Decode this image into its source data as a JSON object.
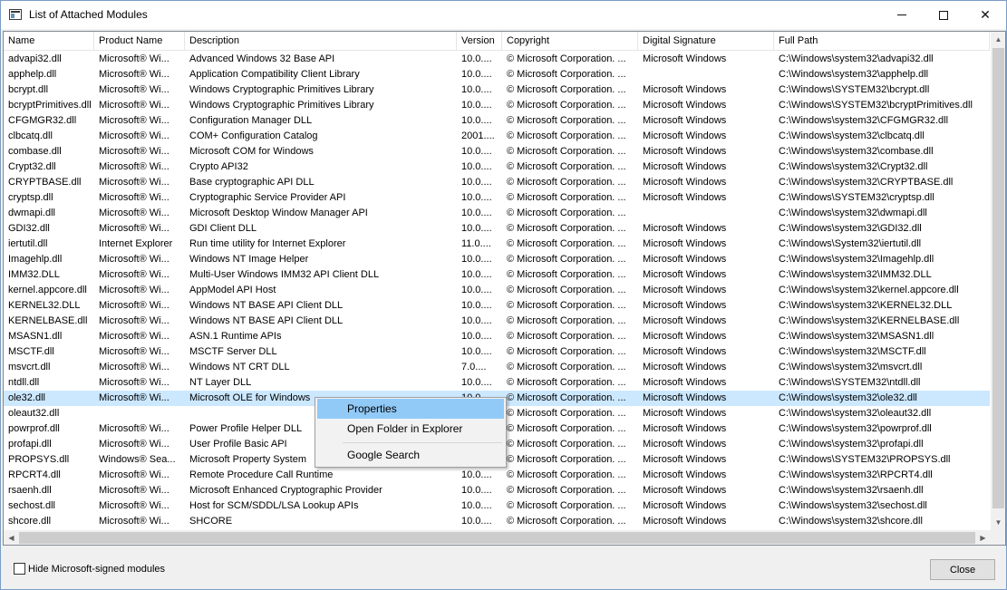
{
  "window": {
    "title": "List of Attached Modules",
    "min_icon": "minimize-icon",
    "max_icon": "maximize-icon",
    "close_icon": "close-icon",
    "close_glyph": "✕"
  },
  "columns": [
    "Name",
    "Product Name",
    "Description",
    "Version",
    "Copyright",
    "Digital Signature",
    "Full Path"
  ],
  "rows": [
    [
      "advapi32.dll",
      "Microsoft® Wi...",
      "Advanced Windows 32 Base API",
      "10.0....",
      "© Microsoft Corporation. ...",
      "Microsoft Windows",
      "C:\\Windows\\system32\\advapi32.dll"
    ],
    [
      "apphelp.dll",
      "Microsoft® Wi...",
      "Application Compatibility Client Library",
      "10.0....",
      "© Microsoft Corporation. ...",
      "",
      "C:\\Windows\\system32\\apphelp.dll"
    ],
    [
      "bcrypt.dll",
      "Microsoft® Wi...",
      "Windows Cryptographic Primitives Library",
      "10.0....",
      "© Microsoft Corporation. ...",
      "Microsoft Windows",
      "C:\\Windows\\SYSTEM32\\bcrypt.dll"
    ],
    [
      "bcryptPrimitives.dll",
      "Microsoft® Wi...",
      "Windows Cryptographic Primitives Library",
      "10.0....",
      "© Microsoft Corporation. ...",
      "Microsoft Windows",
      "C:\\Windows\\SYSTEM32\\bcryptPrimitives.dll"
    ],
    [
      "CFGMGR32.dll",
      "Microsoft® Wi...",
      "Configuration Manager DLL",
      "10.0....",
      "© Microsoft Corporation. ...",
      "Microsoft Windows",
      "C:\\Windows\\system32\\CFGMGR32.dll"
    ],
    [
      "clbcatq.dll",
      "Microsoft® Wi...",
      "COM+ Configuration Catalog",
      "2001....",
      "© Microsoft Corporation. ...",
      "Microsoft Windows",
      "C:\\Windows\\system32\\clbcatq.dll"
    ],
    [
      "combase.dll",
      "Microsoft® Wi...",
      "Microsoft COM for Windows",
      "10.0....",
      "© Microsoft Corporation. ...",
      "Microsoft Windows",
      "C:\\Windows\\system32\\combase.dll"
    ],
    [
      "Crypt32.dll",
      "Microsoft® Wi...",
      "Crypto API32",
      "10.0....",
      "© Microsoft Corporation. ...",
      "Microsoft Windows",
      "C:\\Windows\\system32\\Crypt32.dll"
    ],
    [
      "CRYPTBASE.dll",
      "Microsoft® Wi...",
      "Base cryptographic API DLL",
      "10.0....",
      "© Microsoft Corporation. ...",
      "Microsoft Windows",
      "C:\\Windows\\system32\\CRYPTBASE.dll"
    ],
    [
      "cryptsp.dll",
      "Microsoft® Wi...",
      "Cryptographic Service Provider API",
      "10.0....",
      "© Microsoft Corporation. ...",
      "Microsoft Windows",
      "C:\\Windows\\SYSTEM32\\cryptsp.dll"
    ],
    [
      "dwmapi.dll",
      "Microsoft® Wi...",
      "Microsoft Desktop Window Manager API",
      "10.0....",
      "© Microsoft Corporation. ...",
      "",
      "C:\\Windows\\system32\\dwmapi.dll"
    ],
    [
      "GDI32.dll",
      "Microsoft® Wi...",
      "GDI Client DLL",
      "10.0....",
      "© Microsoft Corporation. ...",
      "Microsoft Windows",
      "C:\\Windows\\system32\\GDI32.dll"
    ],
    [
      "iertutil.dll",
      "Internet Explorer",
      "Run time utility for Internet Explorer",
      "11.0....",
      "© Microsoft Corporation. ...",
      "Microsoft Windows",
      "C:\\Windows\\System32\\iertutil.dll"
    ],
    [
      "Imagehlp.dll",
      "Microsoft® Wi...",
      "Windows NT Image Helper",
      "10.0....",
      "© Microsoft Corporation. ...",
      "Microsoft Windows",
      "C:\\Windows\\system32\\Imagehlp.dll"
    ],
    [
      "IMM32.DLL",
      "Microsoft® Wi...",
      "Multi-User Windows IMM32 API Client DLL",
      "10.0....",
      "© Microsoft Corporation. ...",
      "Microsoft Windows",
      "C:\\Windows\\system32\\IMM32.DLL"
    ],
    [
      "kernel.appcore.dll",
      "Microsoft® Wi...",
      "AppModel API Host",
      "10.0....",
      "© Microsoft Corporation. ...",
      "Microsoft Windows",
      "C:\\Windows\\system32\\kernel.appcore.dll"
    ],
    [
      "KERNEL32.DLL",
      "Microsoft® Wi...",
      "Windows NT BASE API Client DLL",
      "10.0....",
      "© Microsoft Corporation. ...",
      "Microsoft Windows",
      "C:\\Windows\\system32\\KERNEL32.DLL"
    ],
    [
      "KERNELBASE.dll",
      "Microsoft® Wi...",
      "Windows NT BASE API Client DLL",
      "10.0....",
      "© Microsoft Corporation. ...",
      "Microsoft Windows",
      "C:\\Windows\\system32\\KERNELBASE.dll"
    ],
    [
      "MSASN1.dll",
      "Microsoft® Wi...",
      "ASN.1 Runtime APIs",
      "10.0....",
      "© Microsoft Corporation. ...",
      "Microsoft Windows",
      "C:\\Windows\\system32\\MSASN1.dll"
    ],
    [
      "MSCTF.dll",
      "Microsoft® Wi...",
      "MSCTF Server DLL",
      "10.0....",
      "© Microsoft Corporation. ...",
      "Microsoft Windows",
      "C:\\Windows\\system32\\MSCTF.dll"
    ],
    [
      "msvcrt.dll",
      "Microsoft® Wi...",
      "Windows NT CRT DLL",
      "7.0....",
      "© Microsoft Corporation. ...",
      "Microsoft Windows",
      "C:\\Windows\\system32\\msvcrt.dll"
    ],
    [
      "ntdll.dll",
      "Microsoft® Wi...",
      "NT Layer DLL",
      "10.0....",
      "© Microsoft Corporation. ...",
      "Microsoft Windows",
      "C:\\Windows\\SYSTEM32\\ntdll.dll"
    ],
    [
      "ole32.dll",
      "Microsoft® Wi...",
      "Microsoft OLE for Windows",
      "10.0....",
      "© Microsoft Corporation. ...",
      "Microsoft Windows",
      "C:\\Windows\\system32\\ole32.dll"
    ],
    [
      "oleaut32.dll",
      "",
      "",
      "",
      "© Microsoft Corporation. ...",
      "Microsoft Windows",
      "C:\\Windows\\system32\\oleaut32.dll"
    ],
    [
      "powrprof.dll",
      "Microsoft® Wi...",
      "Power Profile Helper DLL",
      "10.0....",
      "© Microsoft Corporation. ...",
      "Microsoft Windows",
      "C:\\Windows\\system32\\powrprof.dll"
    ],
    [
      "profapi.dll",
      "Microsoft® Wi...",
      "User Profile Basic API",
      "10.0....",
      "© Microsoft Corporation. ...",
      "Microsoft Windows",
      "C:\\Windows\\system32\\profapi.dll"
    ],
    [
      "PROPSYS.dll",
      "Windows® Sea...",
      "Microsoft Property System",
      "10.0....",
      "© Microsoft Corporation. ...",
      "Microsoft Windows",
      "C:\\Windows\\SYSTEM32\\PROPSYS.dll"
    ],
    [
      "RPCRT4.dll",
      "Microsoft® Wi...",
      "Remote Procedure Call Runtime",
      "10.0....",
      "© Microsoft Corporation. ...",
      "Microsoft Windows",
      "C:\\Windows\\system32\\RPCRT4.dll"
    ],
    [
      "rsaenh.dll",
      "Microsoft® Wi...",
      "Microsoft Enhanced Cryptographic Provider",
      "10.0....",
      "© Microsoft Corporation. ...",
      "Microsoft Windows",
      "C:\\Windows\\system32\\rsaenh.dll"
    ],
    [
      "sechost.dll",
      "Microsoft® Wi...",
      "Host for SCM/SDDL/LSA Lookup APIs",
      "10.0....",
      "© Microsoft Corporation. ...",
      "Microsoft Windows",
      "C:\\Windows\\system32\\sechost.dll"
    ],
    [
      "shcore.dll",
      "Microsoft® Wi...",
      "SHCORE",
      "10.0....",
      "© Microsoft Corporation. ...",
      "Microsoft Windows",
      "C:\\Windows\\system32\\shcore.dll"
    ]
  ],
  "selected_row": 22,
  "context_menu": {
    "items": [
      "Properties",
      "Open Folder in Explorer",
      "Google Search"
    ],
    "highlighted": 0
  },
  "footer": {
    "checkbox_label": "Hide Microsoft-signed modules",
    "checked": false,
    "close_label": "Close"
  },
  "scrollbar_icons": {
    "up": "▲",
    "down": "▼",
    "left": "◀",
    "right": "▶"
  },
  "colors": {
    "selection": "#cce8ff",
    "menu_highlight": "#91c9f7"
  }
}
